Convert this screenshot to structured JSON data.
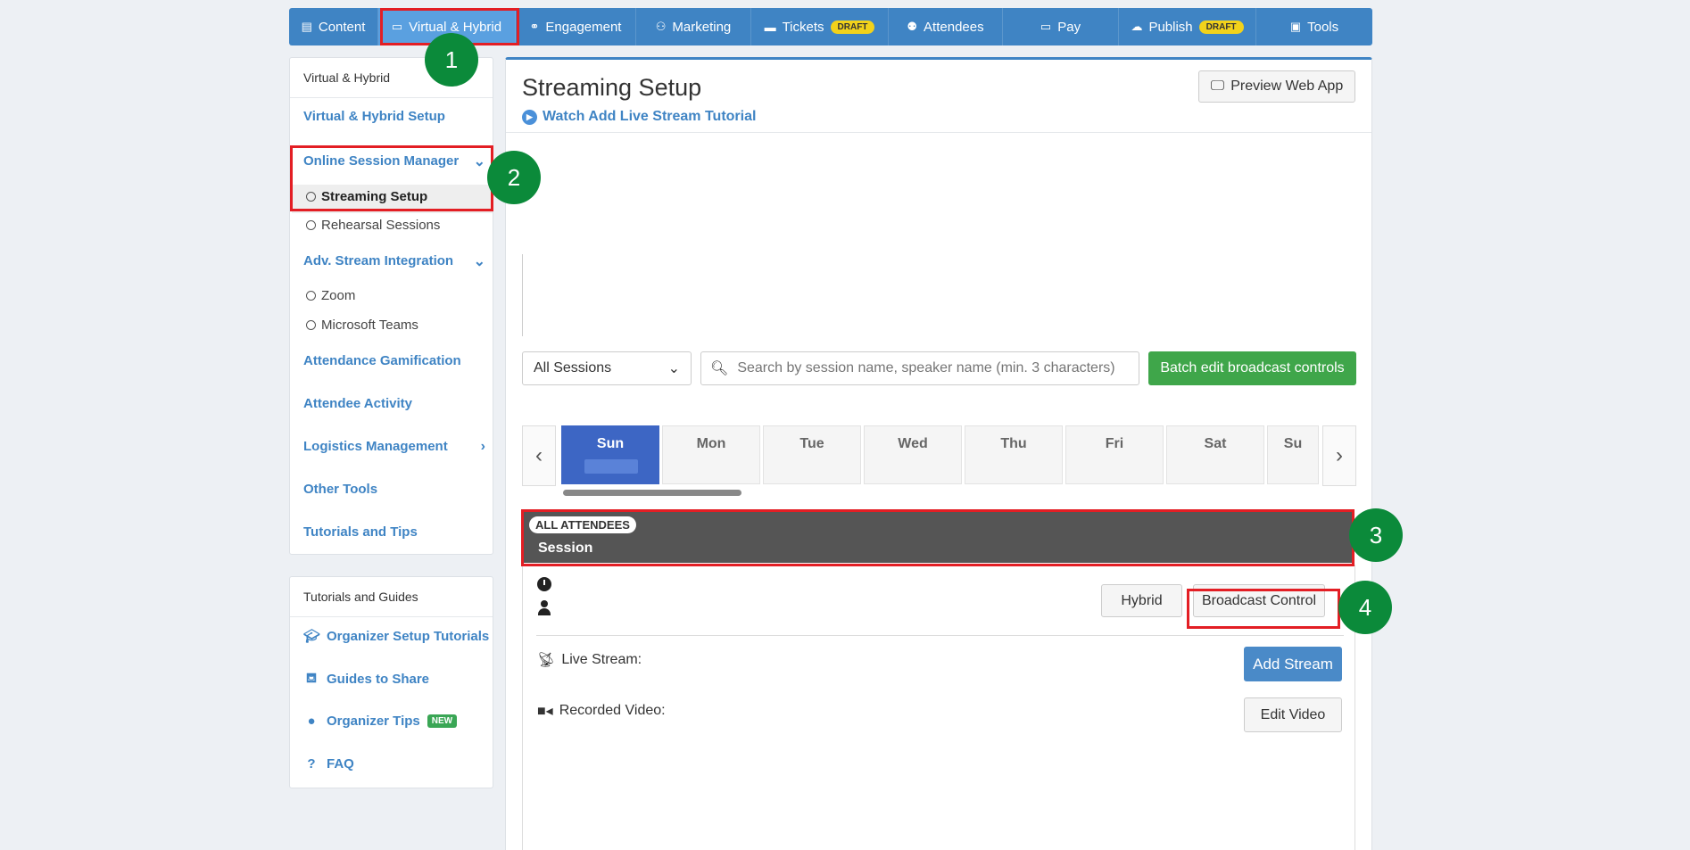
{
  "topnav": {
    "items": [
      {
        "label": "Content",
        "icon": "list-icon"
      },
      {
        "label": "Virtual & Hybrid",
        "icon": "laptop-icon"
      },
      {
        "label": "Engagement",
        "icon": "network-icon"
      },
      {
        "label": "Marketing",
        "icon": "users-icon"
      },
      {
        "label": "Tickets",
        "icon": "ticket-icon",
        "badge": "DRAFT"
      },
      {
        "label": "Attendees",
        "icon": "people-icon"
      },
      {
        "label": "Pay",
        "icon": "card-icon"
      },
      {
        "label": "Publish",
        "icon": "cloud-upload-icon",
        "badge": "DRAFT"
      },
      {
        "label": "Tools",
        "icon": "briefcase-icon"
      }
    ],
    "active_index": 1
  },
  "sidebar": {
    "header": "Virtual & Hybrid",
    "virtual_setup": "Virtual & Hybrid Setup",
    "online_session_manager": "Online Session Manager",
    "streaming_setup": "Streaming Setup",
    "rehearsal_sessions": "Rehearsal Sessions",
    "adv_stream": "Adv. Stream Integration",
    "zoom": "Zoom",
    "teams": "Microsoft Teams",
    "gamification": "Attendance Gamification",
    "activity": "Attendee Activity",
    "logistics": "Logistics Management",
    "other_tools": "Other Tools",
    "tutorials_tips": "Tutorials and Tips"
  },
  "guides": {
    "header": "Tutorials and Guides",
    "organizer_setup": "Organizer Setup Tutorials",
    "guides_share": "Guides to Share",
    "organizer_tips": "Organizer Tips",
    "new_badge": "NEW",
    "faq": "FAQ"
  },
  "main": {
    "title": "Streaming Setup",
    "tutorial_link": "Watch Add Live Stream Tutorial",
    "preview_button": "Preview Web App",
    "sessions_select": "All Sessions",
    "search_placeholder": "Search by session name, speaker name (min. 3 characters)",
    "batch_button": "Batch edit broadcast controls",
    "days": [
      "Sun",
      "Mon",
      "Tue",
      "Wed",
      "Thu",
      "Fri",
      "Sat",
      "Su"
    ],
    "active_day": 0,
    "session_badge": "ALL ATTENDEES",
    "session_title": "Session",
    "hybrid_button": "Hybrid",
    "broadcast_button": "Broadcast Control",
    "live_stream_label": "Live Stream:",
    "recorded_video_label": "Recorded Video:",
    "add_stream_button": "Add Stream",
    "edit_video_button": "Edit Video"
  },
  "annotations": {
    "step1": "1",
    "step2": "2",
    "step3": "3",
    "step4": "4"
  },
  "colors": {
    "nav_bg": "#3f84c4",
    "nav_active": "#5aa0e0",
    "highlight": "#e31e24",
    "step_badge": "#0b8a3a",
    "batch_green": "#3fa64a",
    "day_active": "#3d66c4"
  }
}
